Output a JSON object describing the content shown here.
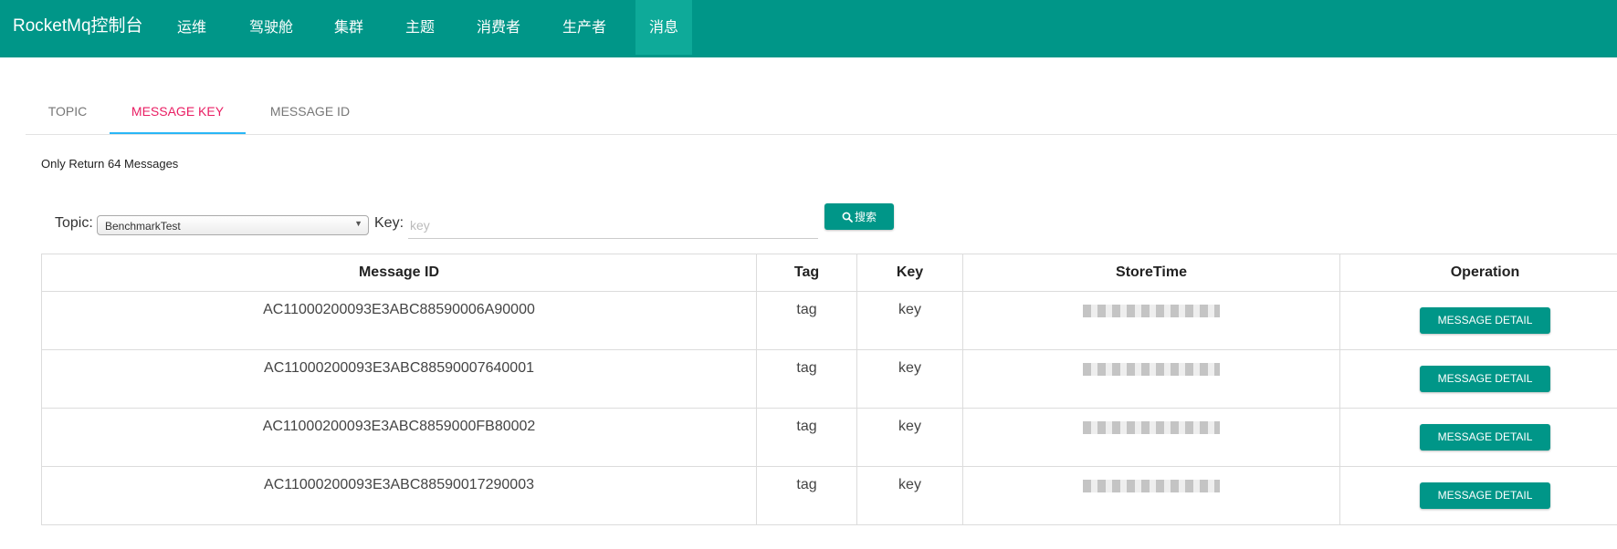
{
  "app": {
    "brand": "RocketMq控制台"
  },
  "nav": {
    "items": [
      {
        "label": "运维"
      },
      {
        "label": "驾驶舱"
      },
      {
        "label": "集群"
      },
      {
        "label": "主题"
      },
      {
        "label": "消费者"
      },
      {
        "label": "生产者"
      },
      {
        "label": "消息"
      }
    ],
    "active_index": 6
  },
  "tabs": [
    {
      "label": "TOPIC"
    },
    {
      "label": "MESSAGE KEY"
    },
    {
      "label": "MESSAGE ID"
    }
  ],
  "active_tab": "MESSAGE KEY",
  "info": "Only Return 64 Messages",
  "search": {
    "topic_label": "Topic:",
    "topic_value": "BenchmarkTest",
    "key_label": "Key:",
    "key_placeholder": "key",
    "key_value": "",
    "button_label": "搜索"
  },
  "table": {
    "headers": [
      "Message ID",
      "Tag",
      "Key",
      "StoreTime",
      "Operation"
    ],
    "rows": [
      {
        "id": "AC11000200093E3ABC88590006A90000",
        "tag": "tag",
        "key": "key",
        "store_time": "",
        "action": "MESSAGE DETAIL"
      },
      {
        "id": "AC11000200093E3ABC88590007640001",
        "tag": "tag",
        "key": "key",
        "store_time": "",
        "action": "MESSAGE DETAIL"
      },
      {
        "id": "AC11000200093E3ABC8859000FB80002",
        "tag": "tag",
        "key": "key",
        "store_time": "",
        "action": "MESSAGE DETAIL"
      },
      {
        "id": "AC11000200093E3ABC88590017290003",
        "tag": "tag",
        "key": "key",
        "store_time": "",
        "action": "MESSAGE DETAIL"
      }
    ]
  },
  "colors": {
    "primary": "#009688",
    "active_tab_text": "#e91e63",
    "tab_indicator": "#29b6f6"
  },
  "icons": {
    "search": "search-icon",
    "dropdown": "dropdown-arrow-icon"
  }
}
